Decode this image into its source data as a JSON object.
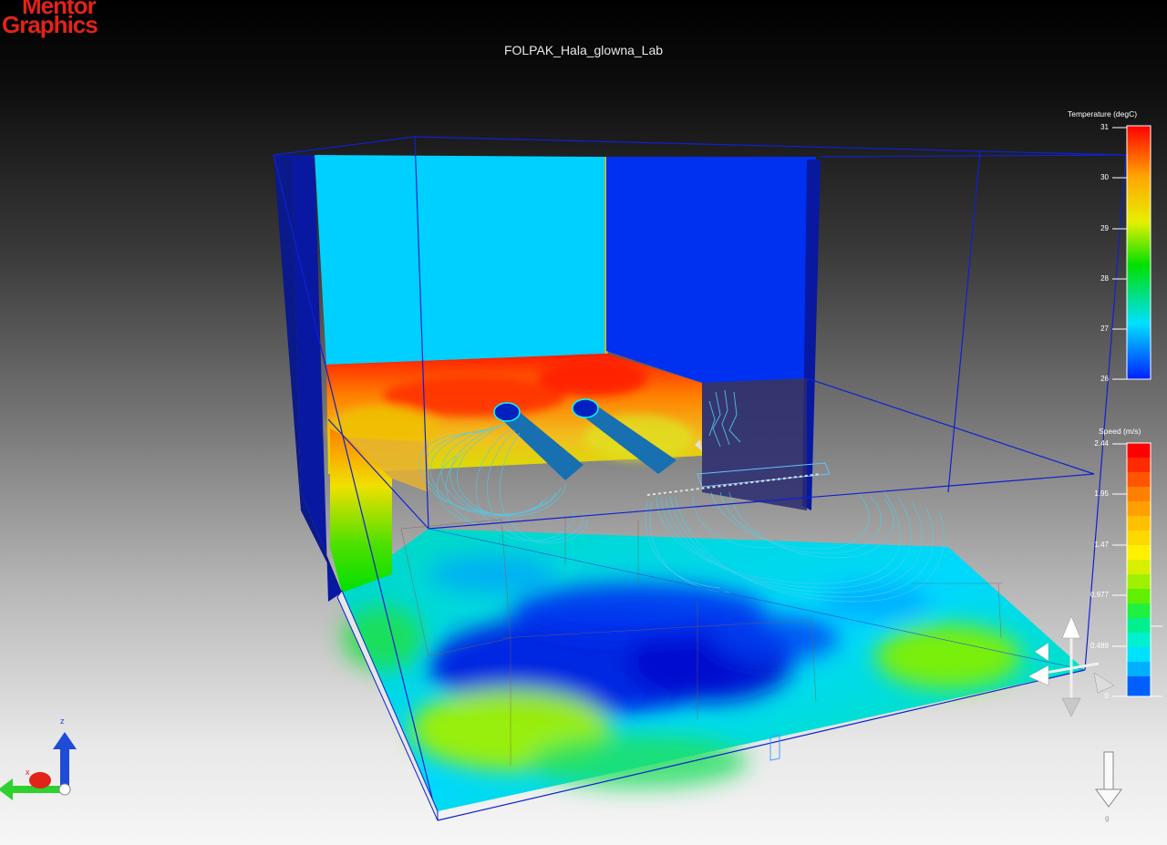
{
  "app": {
    "logo_line1": "Mentor",
    "logo_line2": "Graphics",
    "logo_color": "#e2231a"
  },
  "view": {
    "title": "FOLPAK_Hala_glowna_Lab"
  },
  "legends": {
    "temperature": {
      "title": "Temperature (degC)",
      "ticks": [
        "31",
        "30",
        "29",
        "28",
        "27",
        "26"
      ],
      "scale": "continuous rainbow"
    },
    "speed": {
      "title": "Speed (m/s)",
      "ticks": [
        "2.44",
        "1.95",
        "1.47",
        "0.977",
        "0.489",
        "0"
      ],
      "scale": "banded rainbow"
    }
  },
  "axes": {
    "x_label": "x",
    "z_label": "z",
    "x_color": "#2fd12f",
    "z_color": "#1e4bd8"
  },
  "gravity": {
    "label": "g"
  },
  "icons": [
    "navigation-triad-icon",
    "gravity-arrow-icon",
    "axis-triad-icon"
  ]
}
